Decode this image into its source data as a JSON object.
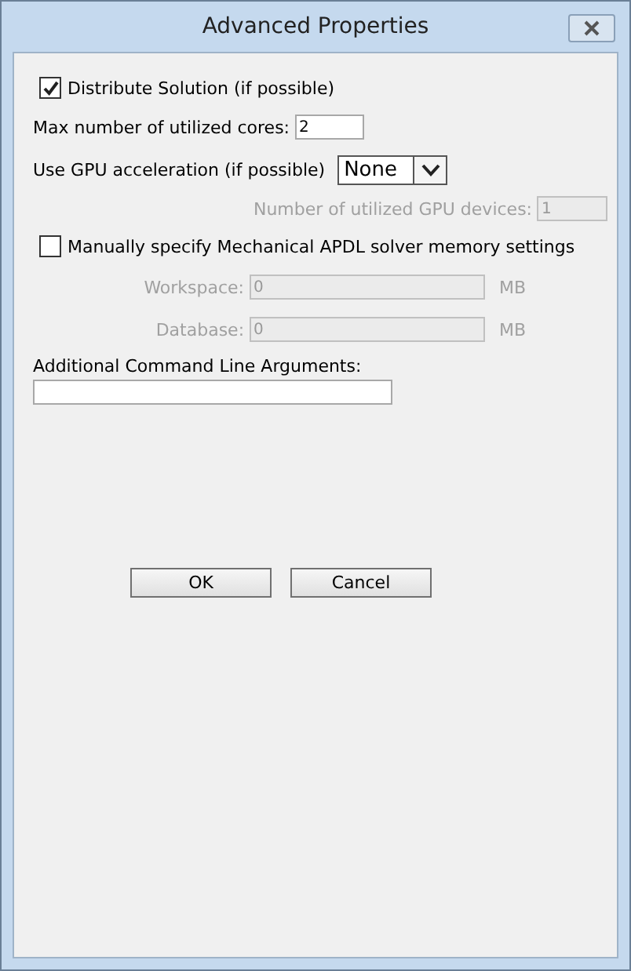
{
  "window": {
    "title": "Advanced Properties"
  },
  "distribute": {
    "label": "Distribute Solution (if possible)",
    "checked": true
  },
  "cores": {
    "label": "Max number of utilized cores:",
    "value": "2",
    "disabled": false
  },
  "gpu": {
    "label": "Use GPU acceleration (if possible)",
    "value": "None"
  },
  "gpu_devices": {
    "label": "Number of utilized GPU devices:",
    "value": "1",
    "disabled": true
  },
  "manual_memory": {
    "label": "Manually specify Mechanical APDL solver memory settings",
    "checked": false
  },
  "memory_fields": [
    {
      "label": "Workspace:",
      "value": "0",
      "unit": "MB",
      "disabled": true
    },
    {
      "label": "Database:",
      "value": "0",
      "unit": "MB",
      "disabled": true
    }
  ],
  "arguments": {
    "label": "Additional Command Line Arguments:"
  },
  "buttons": [
    "OK",
    "Cancel"
  ]
}
